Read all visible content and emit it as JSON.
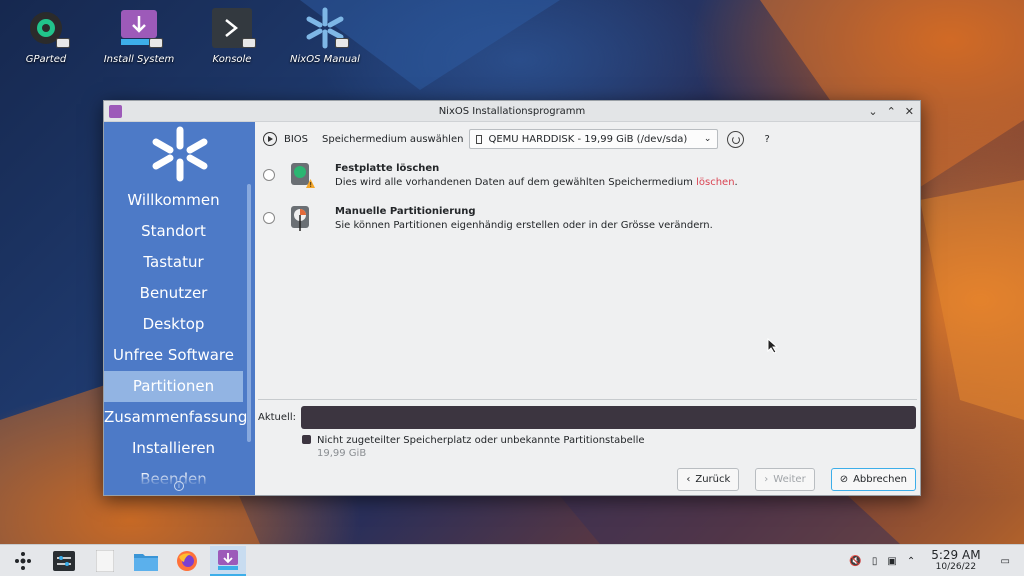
{
  "desktop": {
    "icons": [
      {
        "label": "GParted",
        "icon": "gparted-icon"
      },
      {
        "label": "Install System",
        "icon": "install-icon"
      },
      {
        "label": "Konsole",
        "icon": "terminal-icon"
      },
      {
        "label": "NixOS Manual",
        "icon": "nixos-icon"
      }
    ]
  },
  "window": {
    "title": "NixOS Installationsprogramm",
    "sidebar": {
      "items": [
        {
          "label": "Willkommen"
        },
        {
          "label": "Standort"
        },
        {
          "label": "Tastatur"
        },
        {
          "label": "Benutzer"
        },
        {
          "label": "Desktop"
        },
        {
          "label": "Unfree Software"
        },
        {
          "label": "Partitionen"
        },
        {
          "label": "Zusammenfassung"
        },
        {
          "label": "Installieren"
        },
        {
          "label": "Beenden"
        }
      ],
      "active_index": 6
    },
    "topbar": {
      "firmware": "BIOS",
      "device_label": "Speichermedium auswählen",
      "device_value": "QEMU HARDDISK - 19,99 GiB (/dev/sda)",
      "help": "?"
    },
    "options": [
      {
        "title": "Festplatte löschen",
        "desc_prefix": "Dies wird alle vorhandenen Daten auf dem gewählten Speichermedium ",
        "desc_highlight": "löschen",
        "desc_suffix": "."
      },
      {
        "title": "Manuelle Partitionierung",
        "desc": "Sie können Partitionen eigenhändig erstellen oder in der Grösse verändern."
      }
    ],
    "current": {
      "label": "Aktuell:",
      "legend_label": "Nicht zugeteilter Speicherplatz oder unbekannte Partitionstabelle",
      "legend_size": "19,99 GiB"
    },
    "buttons": {
      "back": "Zurück",
      "next": "Weiter",
      "cancel": "Abbrechen"
    }
  },
  "taskbar": {
    "clock_time": "5:29 AM",
    "clock_date": "10/26/22"
  },
  "colors": {
    "sidebar": "#4d7ac7",
    "sidebar_active": "#92b4e3",
    "accent": "#3daee9",
    "danger": "#da4453"
  }
}
